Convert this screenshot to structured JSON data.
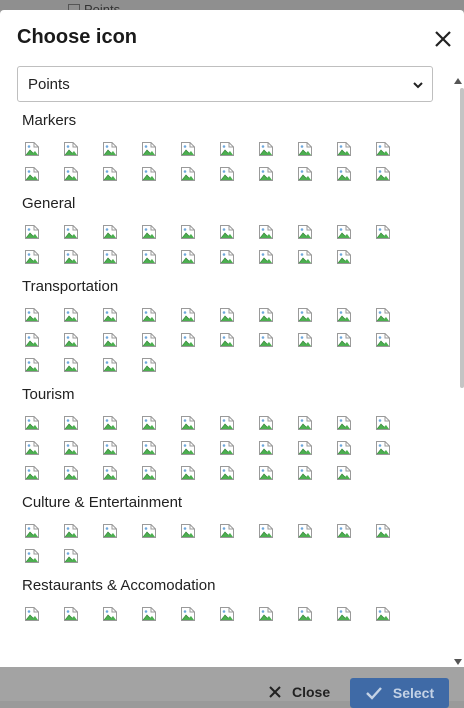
{
  "background": {
    "top_item_label": "Points",
    "close_label": "Close",
    "select_label": "Select"
  },
  "dialog": {
    "title": "Choose icon",
    "close_icon": "close-icon",
    "category_select": {
      "value": "Points"
    },
    "sections": [
      {
        "title": "Markers",
        "icon_count": 20
      },
      {
        "title": "General",
        "icon_count": 19
      },
      {
        "title": "Transportation",
        "icon_count": 24
      },
      {
        "title": "Tourism",
        "icon_count": 29
      },
      {
        "title": "Culture & Entertainment",
        "icon_count": 12
      },
      {
        "title": "Restaurants & Accomodation",
        "icon_count": 10
      }
    ]
  },
  "colors": {
    "primary": "#3f6aa6",
    "overlay": "#9a9a9a"
  }
}
